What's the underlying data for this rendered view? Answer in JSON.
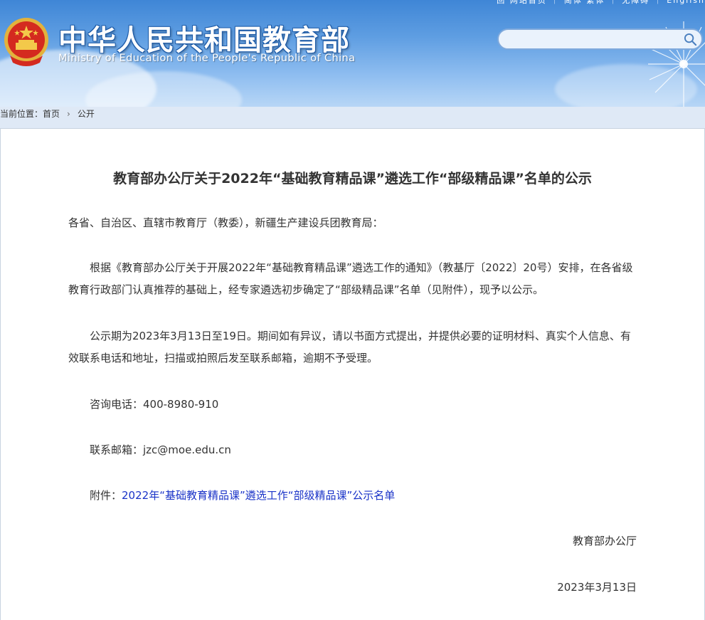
{
  "header": {
    "top_links": "回 网站首页 ｜ 简体 繁体 ｜ 无障碍 ｜ English",
    "title_cn": "中华人民共和国教育部",
    "title_en": "Ministry of Education of the People's Republic of China",
    "search_value": "",
    "search_placeholder": ""
  },
  "breadcrumb": {
    "prefix": "当前位置：",
    "items": [
      "首页",
      "公开"
    ]
  },
  "article": {
    "title": "教育部办公厅关于2022年“基础教育精品课”遴选工作“部级精品课”名单的公示",
    "salutation": "各省、自治区、直辖市教育厅（教委），新疆生产建设兵团教育局：",
    "para1": "根据《教育部办公厅关于开展2022年“基础教育精品课”遴选工作的通知》（教基厅〔2022〕20号）安排，在各省级教育行政部门认真推荐的基础上，经专家遴选初步确定了“部级精品课”名单（见附件），现予以公示。",
    "para2": "公示期为2023年3月13日至19日。期间如有异议，请以书面方式提出，并提供必要的证明材料、真实个人信息、有效联系电话和地址，扫描或拍照后发至联系邮箱，逾期不予受理。",
    "phone_label": "咨询电话：",
    "phone": "400-8980-910",
    "email_label": "联系邮箱：",
    "email": "jzc@moe.edu.cn",
    "attachment_label": "附件：",
    "attachment_link": "2022年“基础教育精品课”遴选工作“部级精品课”公示名单",
    "signature": "教育部办公厅",
    "date": "2023年3月13日"
  },
  "colors": {
    "header_blue": "#3f86d6",
    "breadcrumb_bg": "#dfe9f6",
    "link_blue": "#1a33c8",
    "text": "#333333"
  }
}
